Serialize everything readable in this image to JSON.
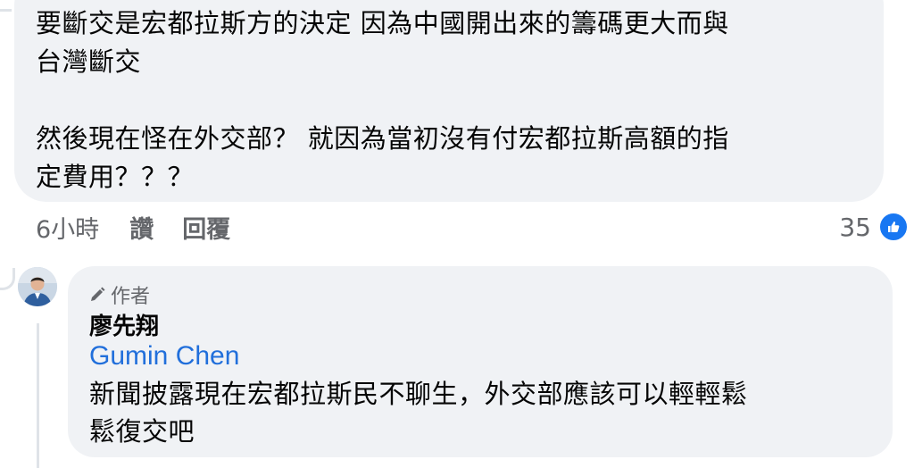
{
  "comment": {
    "text_lines": [
      "要斷交是宏都拉斯方的決定 因為中國開出來的籌碼更大而與",
      "台灣斷交",
      "",
      "然後現在怪在外交部？ 就因為當初沒有付宏都拉斯高額的指",
      "定費用？？？"
    ],
    "time": "6小時",
    "like_label": "讚",
    "reply_label": "回覆",
    "reaction_count": "35",
    "reaction_icon": "like-icon",
    "accent_color": "#1877f2"
  },
  "reply": {
    "author_badge": "作者",
    "author_badge_icon": "pencil-icon",
    "author_name": "廖先翔",
    "mention": "Gumin Chen",
    "text_lines": [
      "新聞披露現在宏都拉斯民不聊生，外交部應該可以輕輕鬆",
      "鬆復交吧"
    ],
    "mention_color": "#216fdb"
  }
}
